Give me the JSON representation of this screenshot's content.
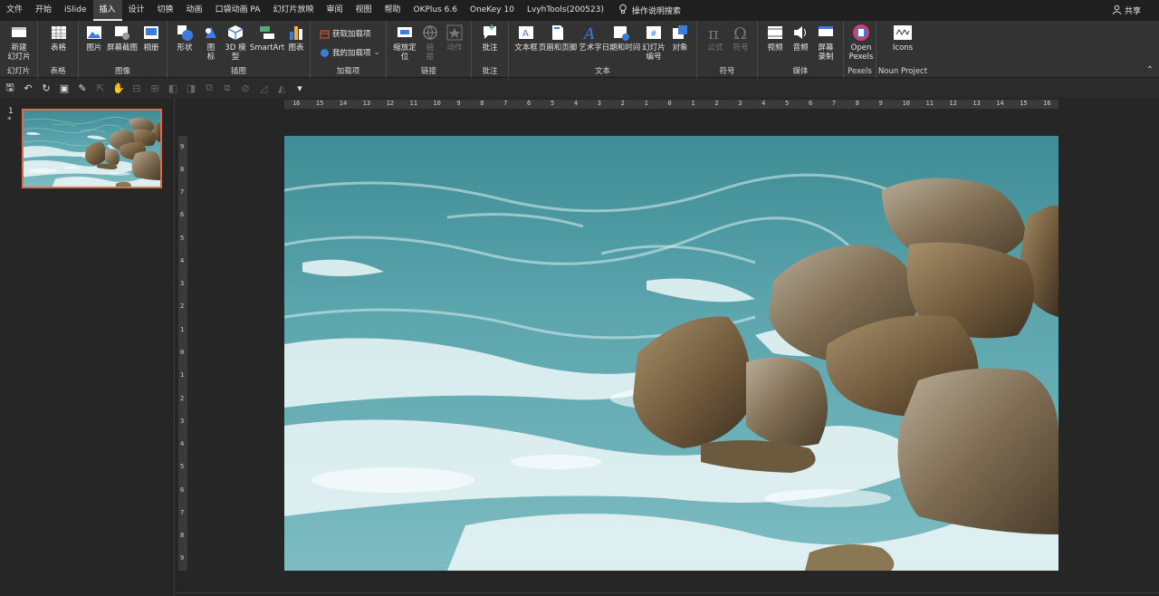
{
  "menu": {
    "tabs": [
      "文件",
      "开始",
      "iSlide",
      "插入",
      "设计",
      "切换",
      "动画",
      "口袋动画 PA",
      "幻灯片放映",
      "审阅",
      "视图",
      "帮助",
      "OKPlus 6.6",
      "OneKey 10",
      "LvyhTools(200523)"
    ],
    "active_tab": "插入",
    "tell_me": "操作说明搜索",
    "share": "共享"
  },
  "ribbon": {
    "groups": {
      "slides": "幻灯片",
      "tables": "表格",
      "images": "图像",
      "illustrations": "插图",
      "addins": "加载项",
      "links": "链接",
      "comments": "批注",
      "text": "文本",
      "symbols": "符号",
      "media": "媒体",
      "pexels": "Pexels",
      "noun": "Noun Project"
    },
    "buttons": {
      "new_slide": "新建\n幻灯片",
      "table": "表格",
      "picture": "图片",
      "screenshot": "屏幕截图",
      "album": "相册",
      "shapes": "形状",
      "icons": "图\n标",
      "model3d": "3D 模\n型",
      "smartart": "SmartArt",
      "chart": "图表",
      "get_addins": "获取加载项",
      "my_addins": "我的加载项",
      "zoom": "缩放定\n位",
      "link": "链\n接",
      "action": "动作",
      "comment": "批注",
      "textbox": "文本框",
      "header_footer": "页眉和页脚",
      "wordart": "艺术字",
      "datetime": "日期和时间",
      "slide_number": "幻灯片\n编号",
      "object": "对象",
      "equation": "公式",
      "symbol": "符号",
      "video": "视频",
      "audio": "音频",
      "screen_recording": "屏幕\n录制",
      "open_pexels": "Open\nPexels",
      "icons_noun": "Icons"
    }
  },
  "slides": {
    "current_number": "1",
    "star": "*"
  },
  "ruler": {
    "h_ticks": [
      "16",
      "15",
      "14",
      "13",
      "12",
      "11",
      "10",
      "9",
      "8",
      "7",
      "6",
      "5",
      "4",
      "3",
      "2",
      "1",
      "0",
      "1",
      "2",
      "3",
      "4",
      "5",
      "6",
      "7",
      "8",
      "9",
      "10",
      "11",
      "12",
      "13",
      "14",
      "15",
      "16"
    ],
    "v_ticks": [
      "9",
      "8",
      "7",
      "6",
      "5",
      "4",
      "3",
      "2",
      "1",
      "0",
      "1",
      "2",
      "3",
      "4",
      "5",
      "6",
      "7",
      "8",
      "9"
    ]
  },
  "colors": {
    "accent_tab": "#404040",
    "thumb_border": "#e06a4a",
    "water": "#5fa5ad",
    "rock": "#7a6a52"
  }
}
